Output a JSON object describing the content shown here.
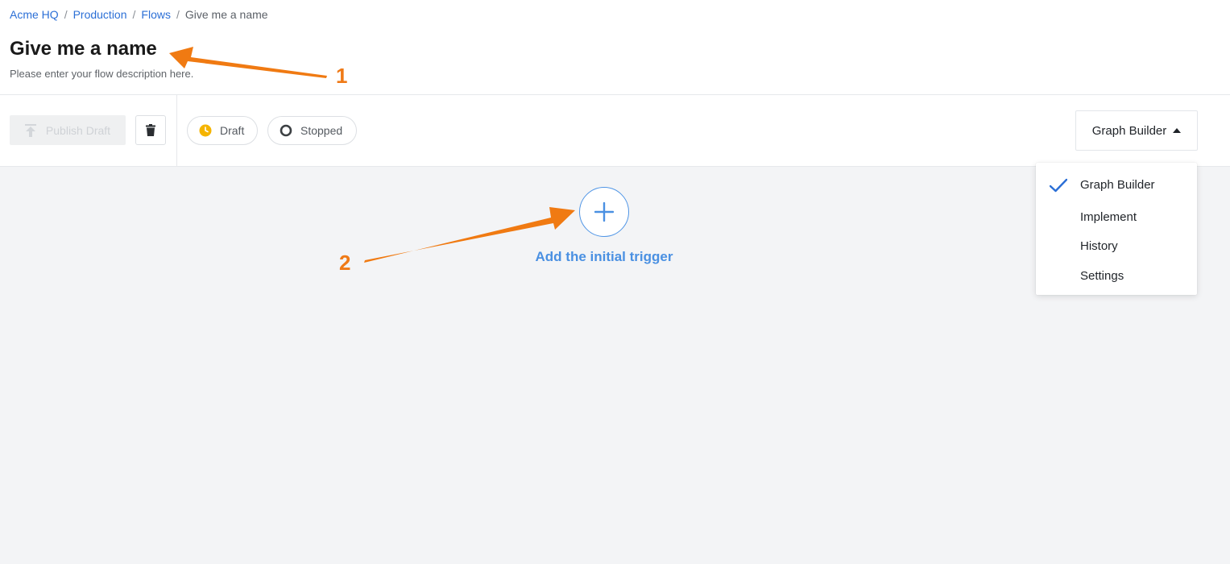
{
  "breadcrumb": {
    "items": [
      {
        "label": "Acme HQ"
      },
      {
        "label": "Production"
      },
      {
        "label": "Flows"
      },
      {
        "label": "Give me a name"
      }
    ],
    "separator": "/"
  },
  "page": {
    "title": "Give me a name",
    "description": "Please enter your flow description here."
  },
  "toolbar": {
    "publish_label": "Publish Draft",
    "publish_icon": "upload-icon",
    "delete_icon": "trash-icon",
    "status_pills": [
      {
        "label": "Draft",
        "icon": "clock-icon",
        "color": "#f5b400"
      },
      {
        "label": "Stopped",
        "icon": "stopped-ring-icon",
        "color": "#3c4043"
      }
    ],
    "view_dropdown": {
      "selected": "Graph Builder",
      "icon": "caret-up-icon"
    }
  },
  "view_menu": {
    "items": [
      {
        "label": "Graph Builder",
        "checked": true
      },
      {
        "label": "Implement",
        "checked": false
      },
      {
        "label": "History",
        "checked": false
      },
      {
        "label": "Settings",
        "checked": false
      }
    ],
    "check_color": "#2b6fd6"
  },
  "canvas": {
    "add_trigger_label": "Add the initial trigger",
    "add_icon": "plus-icon",
    "accent": "#4a90e2"
  },
  "annotations": {
    "color": "#ef7a17",
    "labels": [
      "1",
      "2"
    ]
  }
}
